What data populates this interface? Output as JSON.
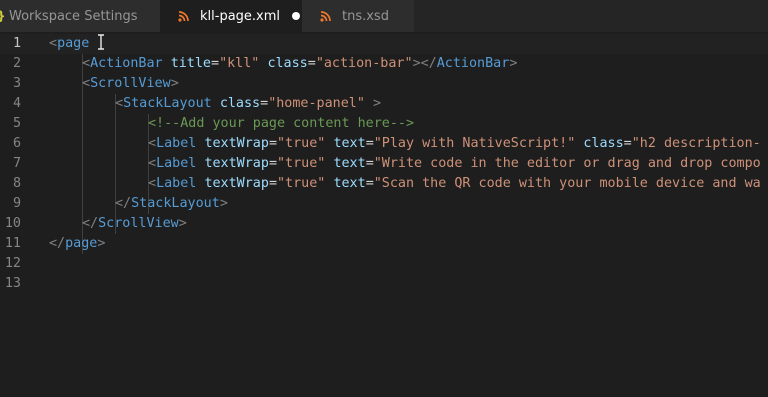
{
  "tabs": [
    {
      "label": "Workspace Settings",
      "icon": "settings-braces-icon",
      "active": false,
      "dirty": false
    },
    {
      "label": "kll-page.xml",
      "icon": "rss-file-icon",
      "active": true,
      "dirty": true
    },
    {
      "label": "tns.xsd",
      "icon": "rss-file-icon",
      "active": false,
      "dirty": false
    }
  ],
  "colors": {
    "editor_bg": "#1e1e1e",
    "tag": "#569cd6",
    "attribute": "#9cdcfe",
    "string": "#ce9178",
    "comment": "#6a9955",
    "bracket": "#808080",
    "file_icon": "#f0772b",
    "line_number": "#858585"
  },
  "editor": {
    "current_line": 1,
    "lines": [
      {
        "num": "1",
        "tokens": [
          [
            "bracket",
            "<"
          ],
          [
            "tag",
            "page"
          ],
          [
            "text",
            " "
          ],
          [
            "cursor",
            "I"
          ]
        ]
      },
      {
        "num": "2",
        "tokens": [
          [
            "bracket",
            "<"
          ],
          [
            "tag",
            "ActionBar"
          ],
          [
            "text",
            " "
          ],
          [
            "attr",
            "title"
          ],
          [
            "eq",
            "="
          ],
          [
            "str",
            "\"kll\""
          ],
          [
            "text",
            " "
          ],
          [
            "attr",
            "class"
          ],
          [
            "eq",
            "="
          ],
          [
            "str",
            "\"action-bar\""
          ],
          [
            "bracket",
            ">"
          ],
          [
            "bracket",
            "</"
          ],
          [
            "tag",
            "ActionBar"
          ],
          [
            "bracket",
            ">"
          ]
        ]
      },
      {
        "num": "3",
        "tokens": [
          [
            "bracket",
            "<"
          ],
          [
            "tag",
            "ScrollView"
          ],
          [
            "bracket",
            ">"
          ]
        ]
      },
      {
        "num": "4",
        "tokens": [
          [
            "bracket",
            "<"
          ],
          [
            "tag",
            "StackLayout"
          ],
          [
            "text",
            " "
          ],
          [
            "attr",
            "class"
          ],
          [
            "eq",
            "="
          ],
          [
            "str",
            "\"home-panel\""
          ],
          [
            "text",
            " "
          ],
          [
            "bracket",
            ">"
          ]
        ]
      },
      {
        "num": "5",
        "tokens": [
          [
            "comment",
            "<!--Add your page content here-->"
          ]
        ]
      },
      {
        "num": "6",
        "tokens": [
          [
            "bracket",
            "<"
          ],
          [
            "tag",
            "Label"
          ],
          [
            "text",
            " "
          ],
          [
            "attr",
            "textWrap"
          ],
          [
            "eq",
            "="
          ],
          [
            "str",
            "\"true\""
          ],
          [
            "text",
            " "
          ],
          [
            "attr",
            "text"
          ],
          [
            "eq",
            "="
          ],
          [
            "str",
            "\"Play with NativeScript!\""
          ],
          [
            "text",
            " "
          ],
          [
            "attr",
            "class"
          ],
          [
            "eq",
            "="
          ],
          [
            "str",
            "\"h2 description-"
          ]
        ]
      },
      {
        "num": "7",
        "tokens": [
          [
            "bracket",
            "<"
          ],
          [
            "tag",
            "Label"
          ],
          [
            "text",
            " "
          ],
          [
            "attr",
            "textWrap"
          ],
          [
            "eq",
            "="
          ],
          [
            "str",
            "\"true\""
          ],
          [
            "text",
            " "
          ],
          [
            "attr",
            "text"
          ],
          [
            "eq",
            "="
          ],
          [
            "str",
            "\"Write code in the editor or drag and drop compo"
          ]
        ]
      },
      {
        "num": "8",
        "tokens": [
          [
            "bracket",
            "<"
          ],
          [
            "tag",
            "Label"
          ],
          [
            "text",
            " "
          ],
          [
            "attr",
            "textWrap"
          ],
          [
            "eq",
            "="
          ],
          [
            "str",
            "\"true\""
          ],
          [
            "text",
            " "
          ],
          [
            "attr",
            "text"
          ],
          [
            "eq",
            "="
          ],
          [
            "str",
            "\"Scan the QR code with your mobile device and wa"
          ]
        ]
      },
      {
        "num": "9",
        "tokens": [
          [
            "bracket",
            "</"
          ],
          [
            "tag",
            "StackLayout"
          ],
          [
            "bracket",
            ">"
          ]
        ]
      },
      {
        "num": "10",
        "tokens": [
          [
            "bracket",
            "</"
          ],
          [
            "tag",
            "ScrollView"
          ],
          [
            "bracket",
            ">"
          ]
        ]
      },
      {
        "num": "11",
        "tokens": [
          [
            "bracket",
            "</"
          ],
          [
            "tag",
            "page"
          ],
          [
            "bracket",
            ">"
          ]
        ]
      },
      {
        "num": "12",
        "tokens": []
      },
      {
        "num": "13",
        "tokens": []
      }
    ]
  }
}
